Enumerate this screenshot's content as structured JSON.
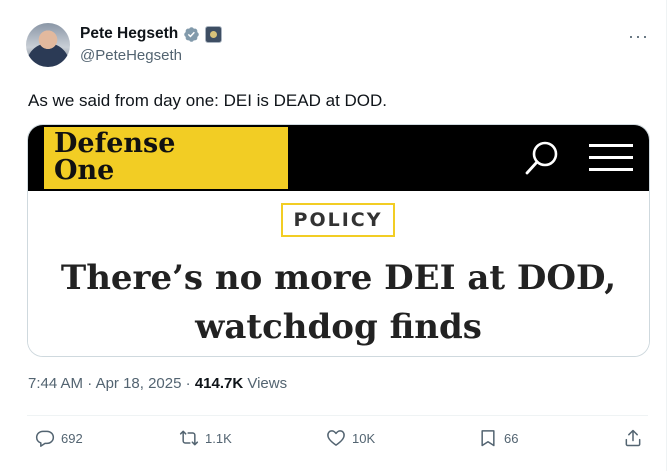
{
  "author": {
    "name": "Pete Hegseth",
    "handle": "@PeteHegseth",
    "verified_badge_icon": "verified-badge-icon",
    "affiliation_icon": "government-affiliation-icon"
  },
  "more_icon": "more-horizontal-icon",
  "tweet_text": "As we said from day one: DEI is DEAD at DOD.",
  "card": {
    "logo_line1": "Defense",
    "logo_line2": "One",
    "logo_color": "#f2cd24",
    "banner_color": "#000000",
    "search_icon": "search-icon",
    "menu_icon": "hamburger-menu-icon",
    "category": "POLICY",
    "headline_line1": "There’s no more DEI at DOD,",
    "headline_line2": "watchdog finds"
  },
  "meta": {
    "time": "7:44 AM",
    "dot1": "·",
    "date": "Apr 18, 2025",
    "dot2": "·",
    "views_count": "414.7K",
    "views_label": "Views"
  },
  "actions": {
    "replies": "692",
    "reposts": "1.1K",
    "likes": "10K",
    "bookmarks": "66"
  }
}
